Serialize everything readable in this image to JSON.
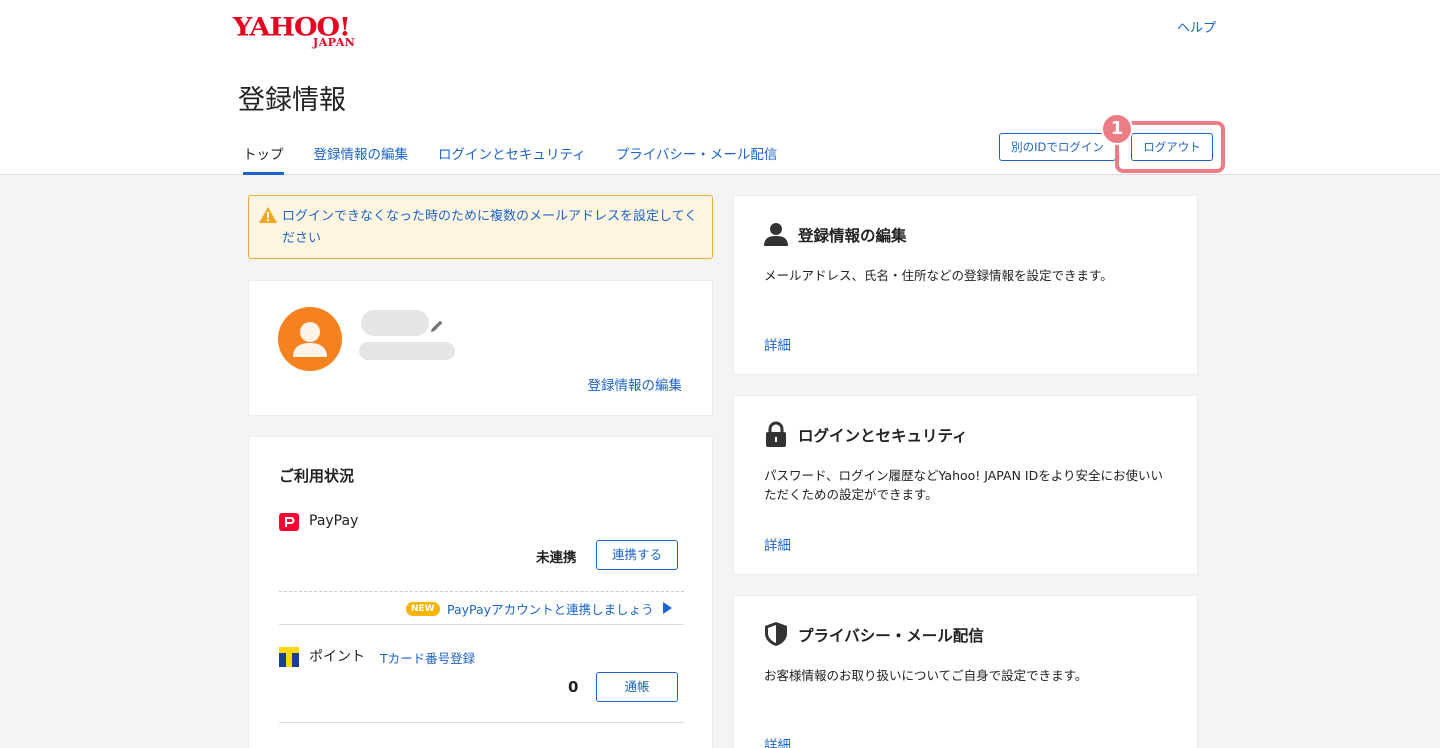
{
  "brand": {
    "logo_main": "YAHOO!",
    "logo_sub": "JAPAN"
  },
  "header": {
    "help_label": "ヘルプ",
    "page_title": "登録情報",
    "tabs": [
      {
        "label": "トップ",
        "active": true
      },
      {
        "label": "登録情報の編集",
        "active": false
      },
      {
        "label": "ログインとセキュリティ",
        "active": false
      },
      {
        "label": "プライバシー・メール配信",
        "active": false
      }
    ],
    "login_other_label": "別のIDでログイン",
    "logout_label": "ログアウト",
    "step_badge": "1"
  },
  "alert": {
    "text": "ログインできなくなった時のために複数のメールアドレスを設定してください"
  },
  "profile": {
    "edit_link": "登録情報の編集"
  },
  "usage": {
    "title": "ご利用状況",
    "paypay": {
      "label": "PayPay",
      "status": "未連携",
      "button_label": "連携する",
      "new_badge": "NEW",
      "promo_link": "PayPayアカウントと連携しましょう"
    },
    "points": {
      "label": "ポイント",
      "tcard_link": "Tカード番号登録",
      "value": "0",
      "button_label": "通帳"
    }
  },
  "sections": [
    {
      "title": "登録情報の編集",
      "description": "メールアドレス、氏名・住所などの登録情報を設定できます。",
      "detail_link": "詳細",
      "icon": "person-icon"
    },
    {
      "title": "ログインとセキュリティ",
      "description": "パスワード、ログイン履歴などYahoo! JAPAN IDをより安全にお使いいただくための設定ができます。",
      "detail_link": "詳細",
      "icon": "lock-icon"
    },
    {
      "title": "プライバシー・メール配信",
      "description": "お客様情報のお取り扱いについてご自身で設定できます。",
      "detail_link": "詳細",
      "icon": "shield-icon"
    }
  ],
  "colors": {
    "brand_red": "#e4001e",
    "link_blue": "#1d64c8",
    "highlight_pink": "#ec7d84",
    "avatar_orange": "#f5821f",
    "warning_bg": "#fff6e2"
  }
}
